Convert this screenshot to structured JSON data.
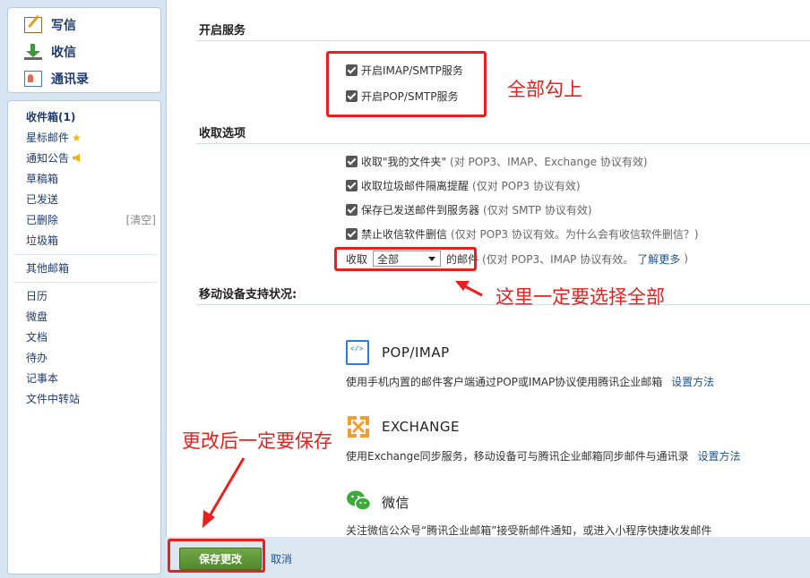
{
  "sidebar": {
    "compose": [
      {
        "label": "写信",
        "icon": "compose-icon"
      },
      {
        "label": "收信",
        "icon": "inbox-download-icon"
      },
      {
        "label": "通讯录",
        "icon": "contacts-icon"
      }
    ],
    "folders": {
      "inbox": "收件箱(1)",
      "starred": "星标邮件",
      "notices": "通知公告",
      "drafts": "草稿箱",
      "sent": "已发送",
      "deleted": "已删除",
      "deleted_clear": "[清空]",
      "spam": "垃圾箱",
      "other": "其他邮箱",
      "calendar": "日历",
      "weidisk": "微盘",
      "docs": "文档",
      "todo": "待办",
      "notes": "记事本",
      "transfer": "文件中转站"
    }
  },
  "main": {
    "enable_service_title": "开启服务",
    "imap_smtp": "开启IMAP/SMTP服务",
    "pop_smtp": "开启POP/SMTP服务",
    "receive_options_title": "收取选项",
    "opt_my_folders": "收取\"我的文件夹\"",
    "opt_my_folders_note": "(对 POP3、IMAP、Exchange 协议有效)",
    "opt_spam_alert": "收取垃圾邮件隔离提醒",
    "opt_spam_alert_note": "(仅对 POP3 协议有效)",
    "opt_save_sent": "保存已发送邮件到服务器",
    "opt_save_sent_note": "(仅对 SMTP 协议有效)",
    "opt_no_delete": "禁止收信软件删信",
    "opt_no_delete_note": "(仅对 POP3 协议有效。为什么会有收信软件删信？)",
    "receive_prefix": "收取",
    "receive_select": "全部",
    "receive_suffix": "的邮件",
    "receive_note": "(仅对 POP3、IMAP 协议有效。",
    "learn_more": "了解更多",
    "receive_note_end": ")",
    "mobile_title": "移动设备支持状况:",
    "pop_imap_title": "POP/IMAP",
    "pop_imap_desc": "使用手机内置的邮件客户端通过POP或IMAP协议使用腾讯企业邮箱",
    "pop_imap_link": "设置方法",
    "exchange_title": "EXCHANGE",
    "exchange_desc": "使用Exchange同步服务，移动设备可与腾讯企业邮箱同步邮件与通讯录",
    "exchange_link": "设置方法",
    "wechat_title": "微信",
    "wechat_desc": "关注微信公众号“腾讯企业邮箱”接受新邮件通知，或进入小程序快捷收发邮件"
  },
  "bottom": {
    "save": "保存更改",
    "cancel": "取消"
  },
  "annotations": {
    "check_all": "全部勾上",
    "select_all": "这里一定要选择全部",
    "must_save": "更改后一定要保存"
  },
  "colors": {
    "annotation_red": "#e8201e",
    "save_green": "#5a942f",
    "link_blue": "#1e5494"
  }
}
